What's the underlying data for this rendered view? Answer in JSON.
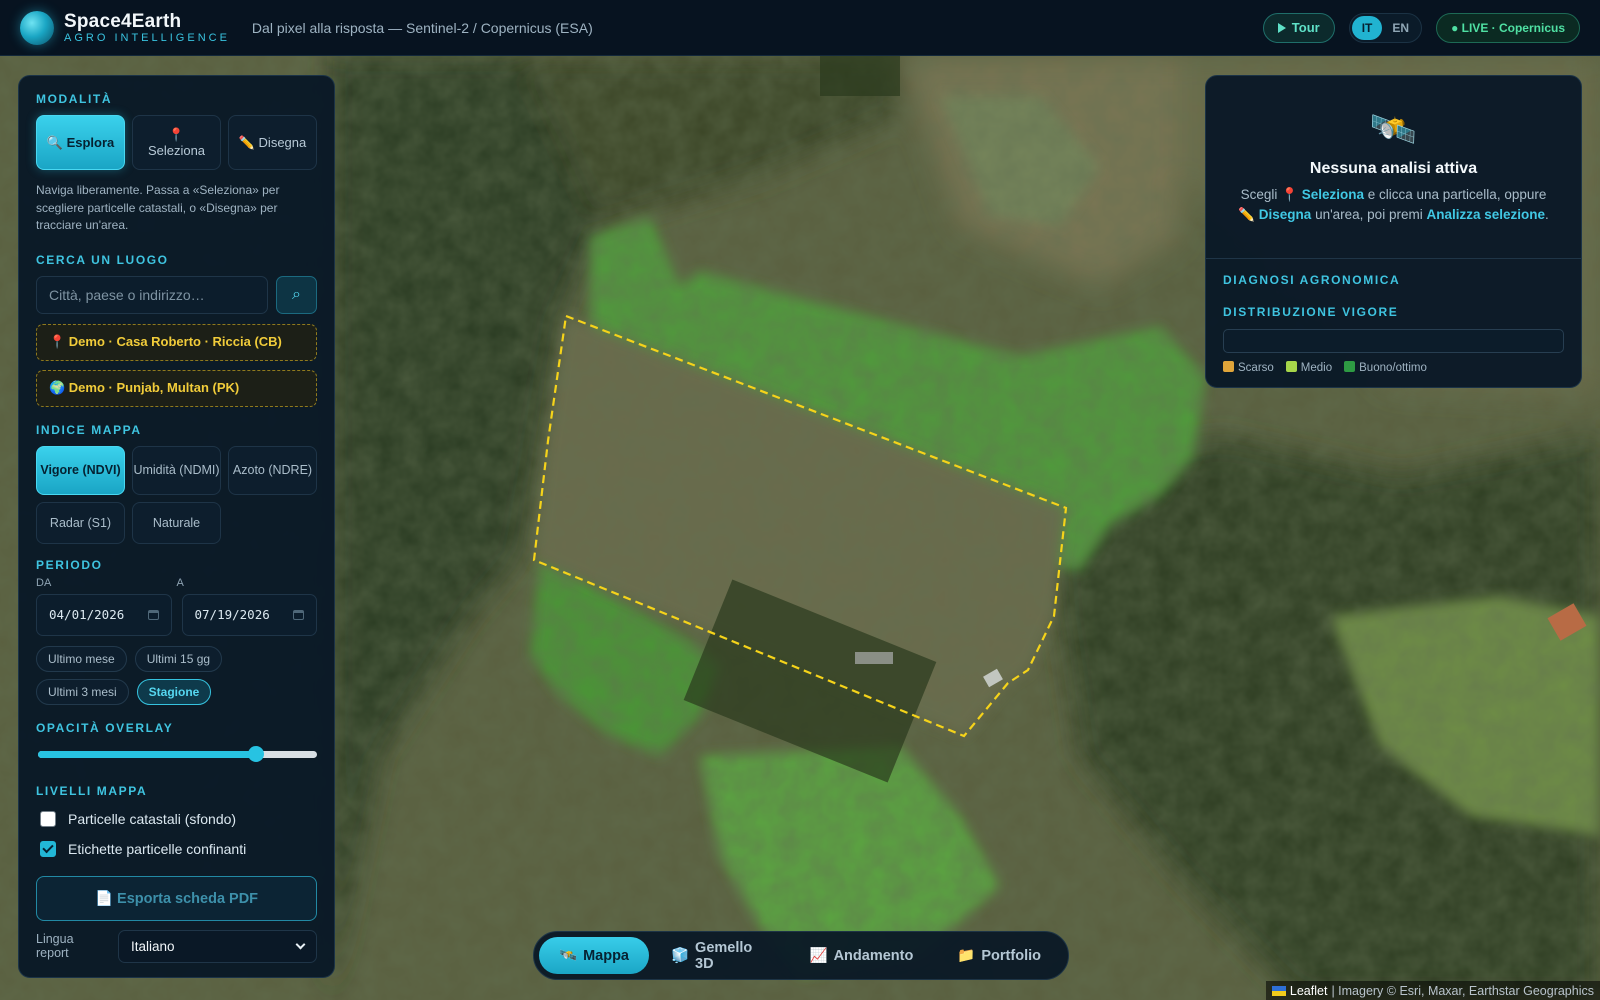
{
  "topbar": {
    "brand_name": "Space4Earth",
    "brand_sub": "AGRO INTELLIGENCE",
    "tagline": "Dal pixel alla risposta — Sentinel-2 / Copernicus (ESA)",
    "tour_label": "Tour",
    "lang_it": "IT",
    "lang_en": "EN",
    "live_label": "● LIVE · Copernicus"
  },
  "left": {
    "mode_title": "MODALITÀ",
    "modes": [
      {
        "icon": "🔍",
        "label": "Esplora",
        "active": true
      },
      {
        "icon": "📍",
        "label": "Seleziona",
        "active": false
      },
      {
        "icon": "✏️",
        "label": "Disegna",
        "active": false
      }
    ],
    "mode_desc": "Naviga liberamente. Passa a «Seleziona» per scegliere particelle catastali, o «Disegna» per tracciare un'area.",
    "search_title": "CERCA UN LUOGO",
    "search_placeholder": "Città, paese o indirizzo…",
    "search_icon_glyph": "⌕",
    "demo1": "📍 Demo · Casa Roberto · Riccia (CB)",
    "demo2": "🌍 Demo · Punjab, Multan (PK)",
    "index_title": "INDICE MAPPA",
    "indices": [
      {
        "label": "Vigore (NDVI)",
        "active": true
      },
      {
        "label": "Umidità (NDMI)",
        "active": false
      },
      {
        "label": "Azoto (NDRE)",
        "active": false
      },
      {
        "label": "Radar (S1)",
        "active": false
      },
      {
        "label": "Naturale",
        "active": false
      }
    ],
    "period_title": "PERIODO",
    "from_label": "DA",
    "to_label": "A",
    "date_from": "04/01/2026",
    "date_to": "07/19/2026",
    "chips": [
      "Ultimo mese",
      "Ultimi 15 gg",
      "Ultimi 3 mesi",
      "Stagione"
    ],
    "chip_active": "Stagione",
    "opacity_title": "OPACITÀ OVERLAY",
    "opacity_value": 0.78,
    "layers_title": "LIVELLI MAPPA",
    "layer1": "Particelle catastali (sfondo)",
    "layer1_checked": false,
    "layer2": "Etichette particelle confinanti",
    "layer2_checked": true,
    "export_label": "📄 Esporta scheda PDF",
    "report_label": "Lingua report",
    "report_value": "Italiano"
  },
  "right": {
    "icon": "🛰️",
    "title": "Nessuna analisi attiva",
    "msg_a": "Scegli 📍 ",
    "msg_b": "Seleziona",
    "msg_c": " e clicca una particella, oppure",
    "msg_d": "✏️ ",
    "msg_e": "Disegna",
    "msg_f": " un'area, poi premi ",
    "msg_g": "Analizza selezione",
    "msg_h": ".",
    "diag_title": "DIAGNOSI AGRONOMICA",
    "vigor_title": "DISTRIBUZIONE VIGORE",
    "legend": [
      {
        "label": "Scarso",
        "color": "#e0a53a"
      },
      {
        "label": "Medio",
        "color": "#a6d64a"
      },
      {
        "label": "Buono/ottimo",
        "color": "#2e9a43"
      }
    ]
  },
  "tabs": [
    {
      "icon": "🛰️",
      "label": "Mappa",
      "active": true
    },
    {
      "icon": "🧊",
      "label": "Gemello 3D",
      "active": false
    },
    {
      "icon": "📈",
      "label": "Andamento",
      "active": false
    },
    {
      "icon": "📁",
      "label": "Portfolio",
      "active": false
    }
  ],
  "attribution": {
    "leaflet": "Leaflet",
    "text": "| Imagery © Esri, Maxar, Earthstar Geographics"
  },
  "colors": {
    "accent": "#27c3e2",
    "boundary": "#f5d31a",
    "demo_text": "#f1cc3a"
  }
}
